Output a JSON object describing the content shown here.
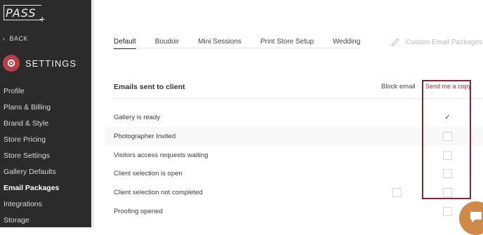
{
  "brand": {
    "logo": "PASS",
    "logo_plus": "+"
  },
  "sidebar": {
    "back_label": "BACK",
    "section_title": "SETTINGS",
    "items": [
      {
        "label": "Profile"
      },
      {
        "label": "Plans & Billing"
      },
      {
        "label": "Brand & Style"
      },
      {
        "label": "Store Pricing"
      },
      {
        "label": "Store Settings"
      },
      {
        "label": "Gallery Defaults"
      },
      {
        "label": "Email Packages",
        "active": true
      },
      {
        "label": "Integrations"
      },
      {
        "label": "Storage"
      }
    ]
  },
  "tabs": [
    {
      "label": "Default",
      "active": true
    },
    {
      "label": "Boudoir"
    },
    {
      "label": "Mini Sessions"
    },
    {
      "label": "Print Store Setup"
    },
    {
      "label": "Wedding"
    }
  ],
  "custom_packages_label": "Custom Email Packages",
  "table": {
    "title": "Emails sent to client",
    "col_block": "Block email",
    "col_copy": "Send me a copy",
    "rows": [
      {
        "label": "Gallery is ready",
        "send_copy": true,
        "shaded": false
      },
      {
        "label": "Photographer Invited",
        "send_copy": false,
        "shaded": true
      },
      {
        "label": "Visitors access requests waiting",
        "send_copy": false,
        "shaded": false
      },
      {
        "label": "Client selection is open",
        "send_copy": false,
        "shaded": false
      },
      {
        "label": "Client selection not completed",
        "send_copy": false,
        "shaded": false,
        "block_box": true
      },
      {
        "label": "Proofing opened",
        "send_copy": false,
        "shaded": false
      }
    ]
  },
  "colors": {
    "sidebar_bg": "#2b2b2b",
    "accent": "#b8404b",
    "highlight": "#7b2930",
    "chat": "#cf8a48"
  },
  "icons": [
    "back-chevron-icon",
    "gear-icon",
    "pencil-icon",
    "check-icon",
    "chat-icon"
  ]
}
